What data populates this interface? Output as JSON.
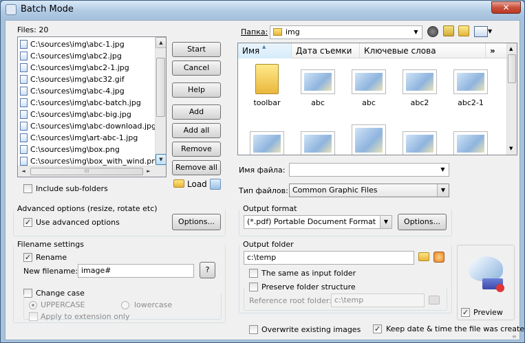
{
  "window": {
    "title": "Batch Mode",
    "close_glyph": "✕"
  },
  "files": {
    "label": "Files: 20",
    "items": [
      "C:\\sources\\img\\abc-1.jpg",
      "C:\\sources\\img\\abc2.jpg",
      "C:\\sources\\img\\abc2-1.jpg",
      "C:\\sources\\img\\abc32.gif",
      "C:\\sources\\img\\abc-4.jpg",
      "C:\\sources\\img\\abc-batch.jpg",
      "C:\\sources\\img\\abc-big.jpg",
      "C:\\sources\\img\\abc-download.jpg",
      "C:\\sources\\img\\art-abc-1.jpg",
      "C:\\sources\\img\\box.png",
      "C:\\sources\\img\\box_with_wind.png"
    ],
    "include_subfolders": "Include sub-folders"
  },
  "buttons": {
    "start": "Start",
    "cancel": "Cancel",
    "help": "Help",
    "add": "Add",
    "add_all": "Add all",
    "remove": "Remove",
    "remove_all": "Remove all",
    "load": "Load",
    "options": "Options...",
    "options2": "Options...",
    "question": "?"
  },
  "advanced": {
    "title": "Advanced options (resize, rotate etc)",
    "use": "Use advanced options"
  },
  "filename": {
    "title": "Filename settings",
    "rename": "Rename",
    "new_label": "New filename:",
    "new_value": "image#",
    "change_case": "Change case",
    "upper": "UPPERCASE",
    "lower": "lowercase",
    "ext_only": "Apply to extension only"
  },
  "browser": {
    "folder_label": "Папка:",
    "folder_value": "img",
    "columns": [
      "Имя",
      "Дата съемки",
      "Ключевые слова"
    ],
    "more": "»",
    "items": [
      "toolbar",
      "abc",
      "abc",
      "abc2",
      "abc2-1"
    ],
    "file_name_label": "Имя файла:",
    "file_name_value": "",
    "file_type_label": "Тип файлов:",
    "file_type_value": "Common Graphic Files"
  },
  "output_format": {
    "title": "Output format",
    "value": "(*.pdf) Portable Document Format"
  },
  "output_folder": {
    "title": "Output folder",
    "value": "c:\\temp",
    "same": "The same as input folder",
    "preserve": "Preserve folder structure",
    "root_label": "Reference root folder:",
    "root_value": "c:\\temp"
  },
  "preview": {
    "label": "Preview"
  },
  "bottom": {
    "overwrite": "Overwrite existing images",
    "keep_date": "Keep date & time the file was created"
  },
  "glyphs": {
    "check": "✓",
    "down": "▼",
    "up": "▲",
    "left": "◄",
    "right": "►",
    "grip": "≡",
    "gripv": "⁞⁞⁞"
  }
}
